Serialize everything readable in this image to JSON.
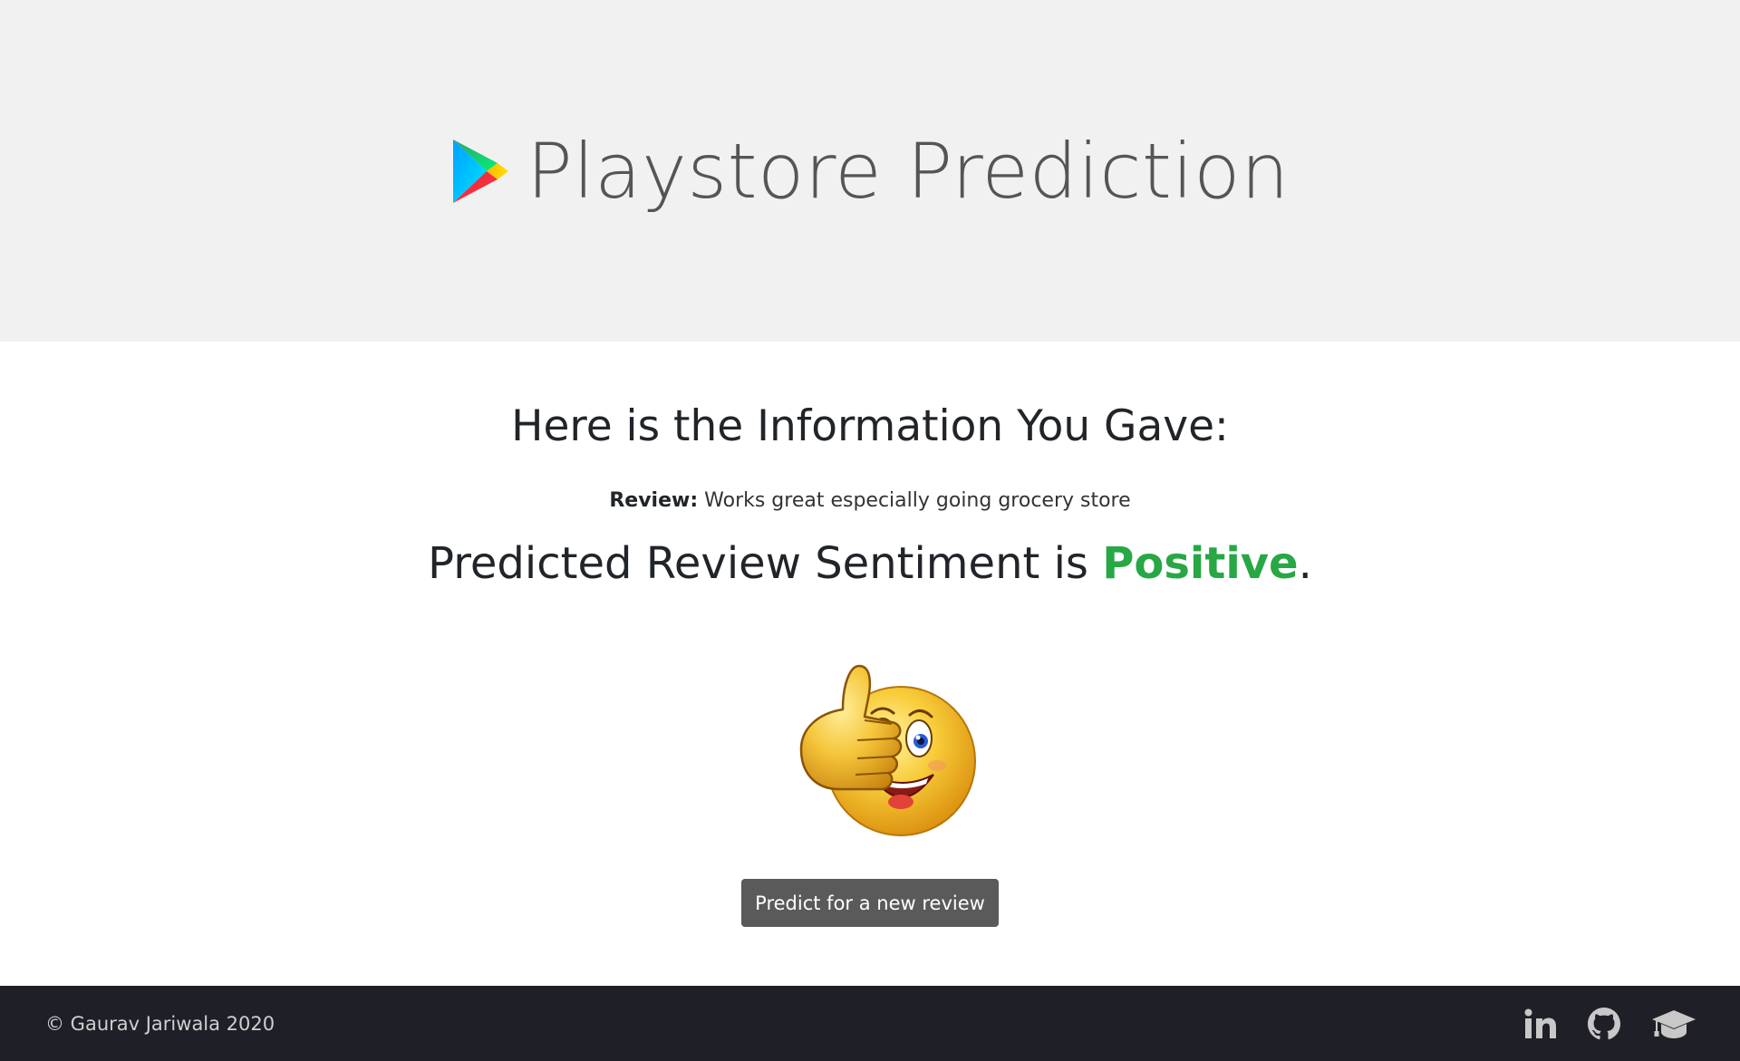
{
  "header": {
    "title": "Playstore Prediction",
    "logo_icon": "google-play-icon",
    "background": "#f1f1f1"
  },
  "main": {
    "heading": "Here is the Information You Gave:",
    "review_label": "Review:",
    "review_text": "Works great especially going grocery store",
    "prediction_prefix": "Predicted Review Sentiment is ",
    "prediction_value": "Positive",
    "prediction_suffix": ".",
    "prediction_color": "#28a745",
    "result_image_icon": "thumbs-up-smiley-icon",
    "new_review_button": "Predict for a new review"
  },
  "footer": {
    "copyright": "© Gaurav Jariwala 2020",
    "background": "#1f1f27",
    "social_icons": [
      "linkedin-icon",
      "github-icon",
      "graduation-cap-icon"
    ]
  }
}
